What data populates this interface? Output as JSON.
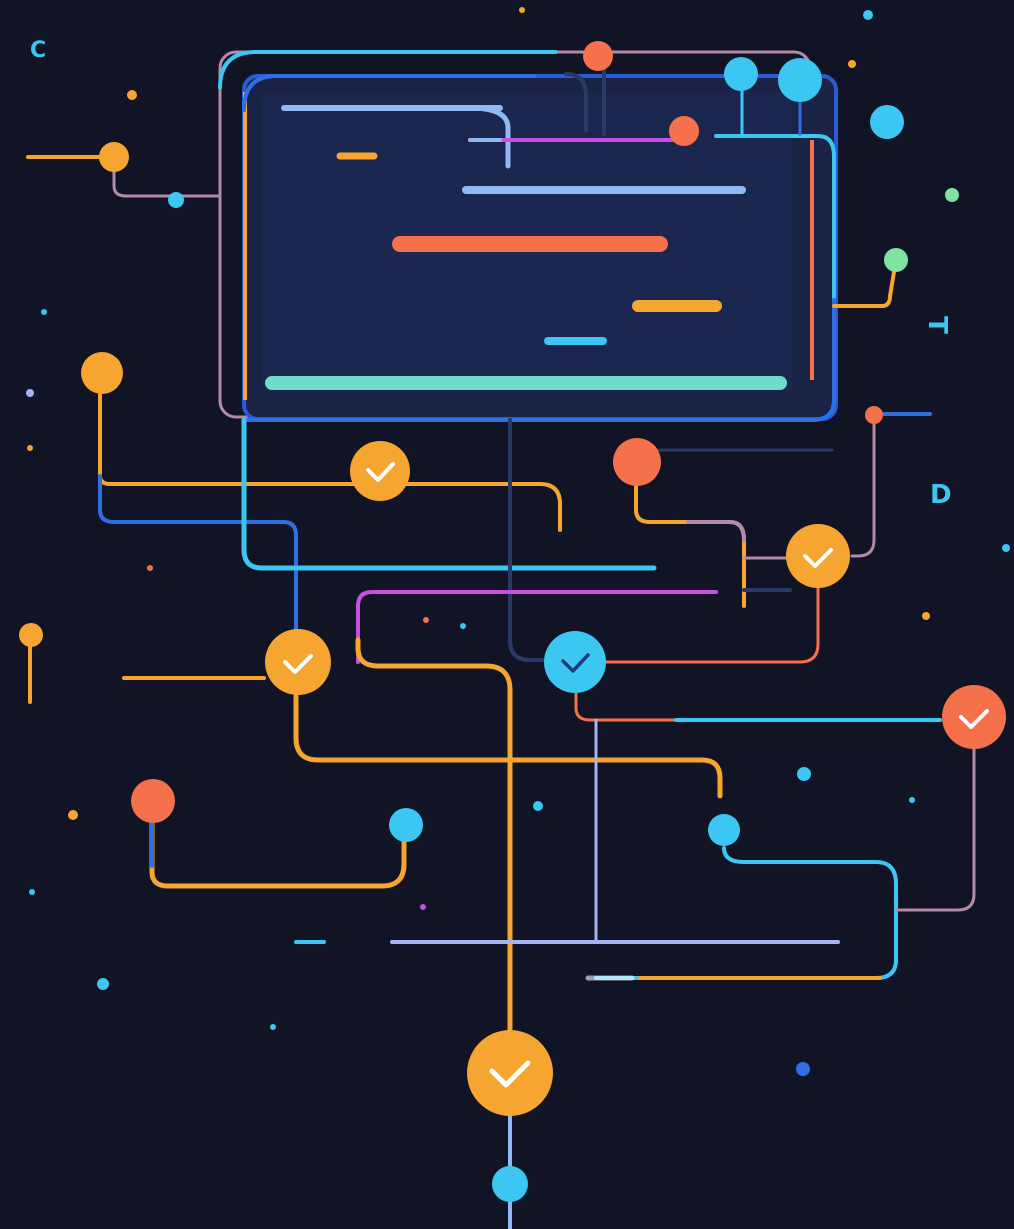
{
  "margin_letters": {
    "c": "C",
    "t": "T",
    "d": "D"
  },
  "colors": {
    "background": "#101424",
    "screen": "#1a2346",
    "screen_border": "#2a5bd6",
    "cyan": "#3cc6f2",
    "orange": "#f7a531",
    "coral": "#f4714b",
    "blue": "#2f6fe3",
    "lavender": "#a8b4f0",
    "magenta": "#c94fe4",
    "mauve": "#b48aa8",
    "mint": "#6fdcc9",
    "green": "#7fe3a4",
    "white": "#ffffff"
  },
  "icons": {
    "check": "check-icon",
    "node": "node-dot"
  }
}
